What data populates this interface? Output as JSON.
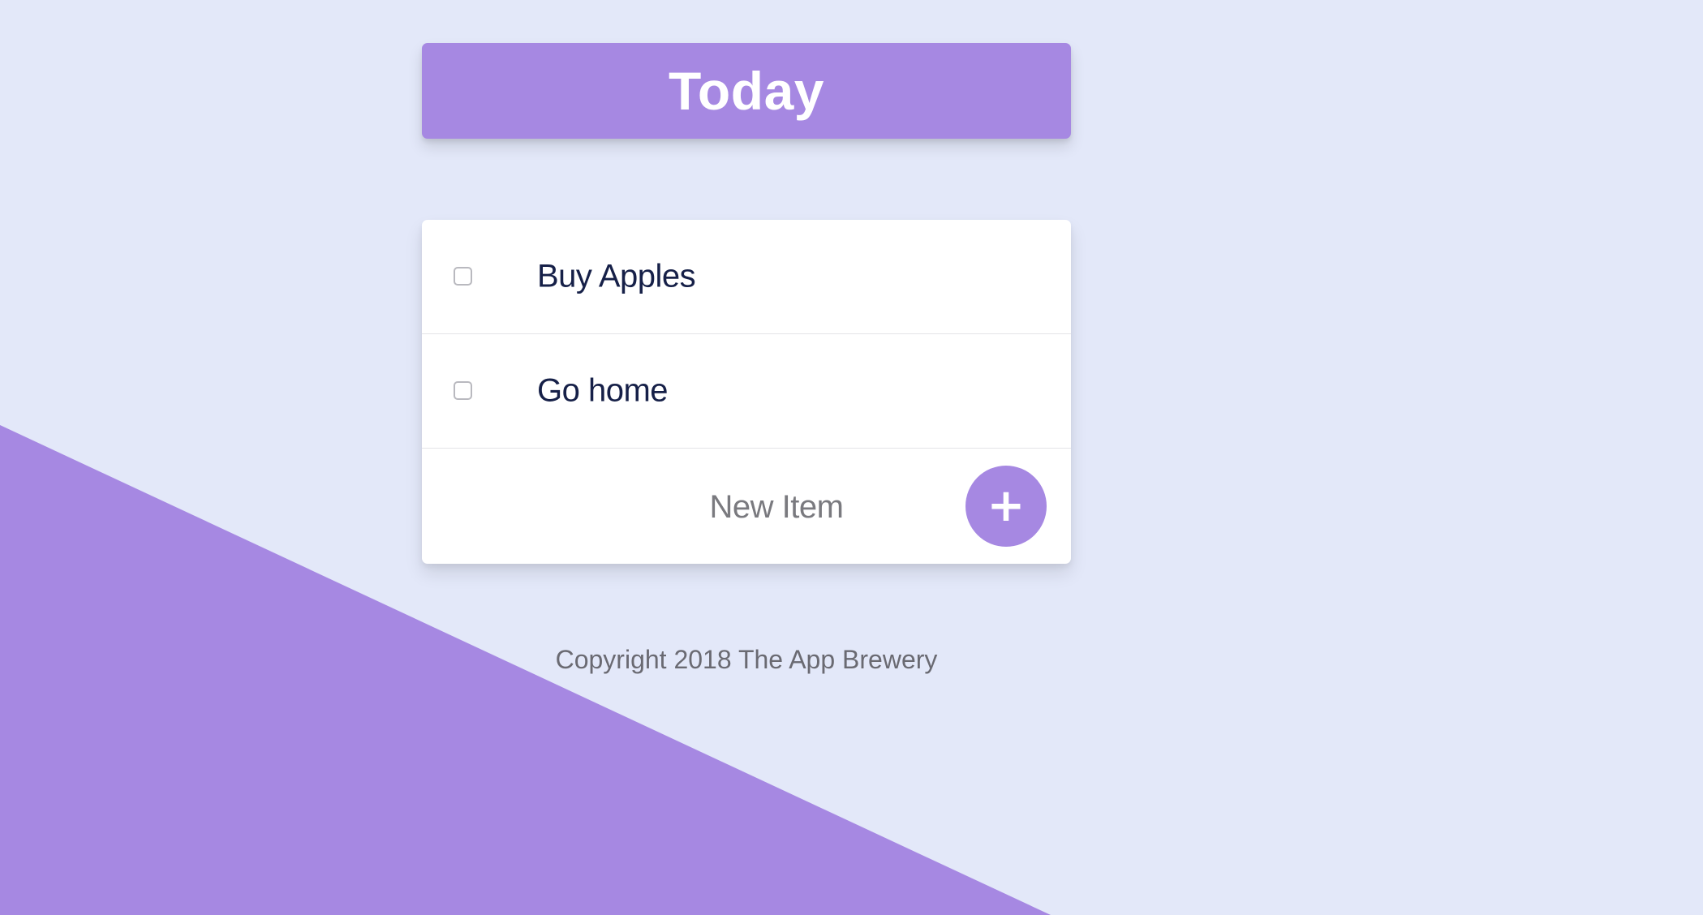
{
  "header": {
    "title": "Today"
  },
  "list": {
    "items": [
      {
        "text": "Buy Apples",
        "checked": false
      },
      {
        "text": "Go home",
        "checked": false
      }
    ],
    "new_item": {
      "placeholder": "New Item",
      "value": "",
      "add_button_label": "+",
      "add_button_icon": "plus-icon"
    }
  },
  "footer": {
    "text": "Copyright 2018 The App Brewery"
  },
  "colors": {
    "background": "#e3e8f9",
    "accent": "#a688e2",
    "card": "#ffffff",
    "item_text": "#162048",
    "footer_text": "#6a6a72"
  }
}
